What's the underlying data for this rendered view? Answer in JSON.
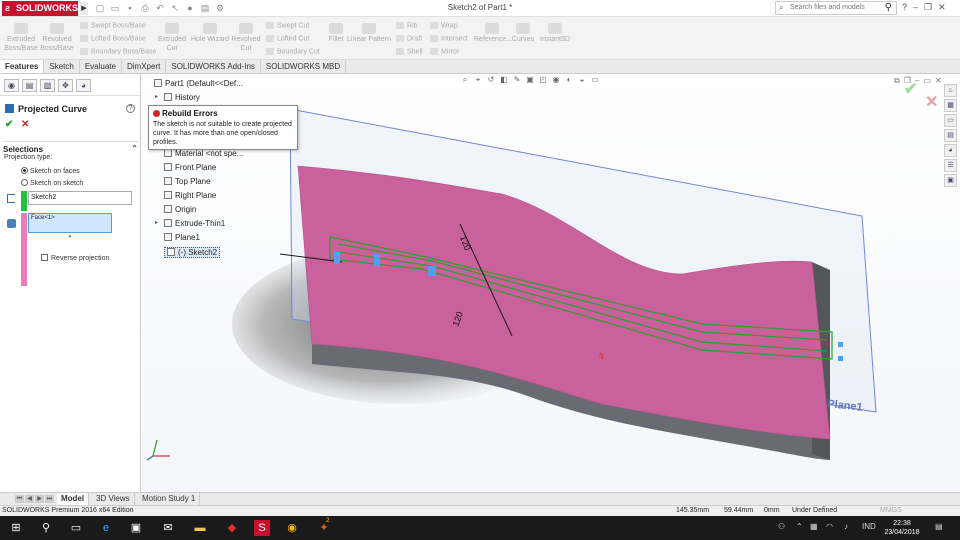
{
  "titlebar": {
    "app_name": "SOLIDWORKS",
    "doc_title": "Sketch2 of Part1 *",
    "search_placeholder": "Search files and models"
  },
  "command_manager": {
    "big": [
      {
        "label": "Extruded\nBoss/Base"
      },
      {
        "label": "Revolved\nBoss/Base"
      },
      {
        "label": "Extruded\nCut"
      },
      {
        "label": "Hole Wizard"
      },
      {
        "label": "Revolved\nCut"
      },
      {
        "label": "Fillet"
      },
      {
        "label": "Linear Pattern"
      },
      {
        "label": "Reference..."
      },
      {
        "label": "Curves"
      },
      {
        "label": "Instant3D"
      }
    ],
    "small": {
      "swept_boss": "Swept Boss/Base",
      "lofted_boss": "Lofted Boss/Base",
      "boundary_boss": "Boundary Boss/Base",
      "swept_cut": "Swept Cut",
      "lofted_cut": "Lofted Cut",
      "boundary_cut": "Boundary Cut",
      "rib": "Rib",
      "draft": "Draft",
      "shell": "Shell",
      "wrap": "Wrap",
      "intersect": "Intersect",
      "mirror": "Mirror"
    }
  },
  "tabs": [
    "Features",
    "Sketch",
    "Evaluate",
    "DimXpert",
    "SOLIDWORKS Add-Ins",
    "SOLIDWORKS MBD"
  ],
  "property_manager": {
    "title": "Projected Curve",
    "help": "?",
    "ok": "✔",
    "cancel": "✕",
    "selections_header": "Selections",
    "projection_type_label": "Projection type:",
    "radio_faces": "Sketch on faces",
    "radio_sketch": "Sketch on sketch",
    "sketch_value": "Sketch2",
    "face_value": "Face<1>",
    "reverse_label": "Reverse projection"
  },
  "feature_tree": {
    "part": "Part1  (Default<<Def...",
    "history": "History",
    "material": "Material <not spe...",
    "front_plane": "Front Plane",
    "top_plane": "Top Plane",
    "right_plane": "Right Plane",
    "origin": "Origin",
    "extrude": "Extrude-Thin1",
    "plane1": "Plane1",
    "sketch2": "(-) Sketch2"
  },
  "rebuild_popup": {
    "title": "Rebuild Errors",
    "message": "The sketch is not suitable to create projected curve. It has more than one open/closed profiles."
  },
  "model": {
    "plane_label": "Plane1",
    "face_color": "#c8619c",
    "side_color": "#6a6a72",
    "sketch_color": "#2e9e2e",
    "plane_border_color": "#6f88d8",
    "dim1": "120",
    "dim2": "120"
  },
  "bottom_tabs": [
    "Model",
    "3D Views",
    "Motion Study 1"
  ],
  "status": {
    "edition": "SOLIDWORKS Premium 2016 x64 Edition",
    "x": "145.35mm",
    "y": "59.44mm",
    "z": "0mm",
    "state": "Under Defined",
    "units": "MMGS"
  },
  "taskbar": {
    "lang": "IND",
    "time": "22:38",
    "date": "23/04/2018",
    "badge": "2"
  }
}
